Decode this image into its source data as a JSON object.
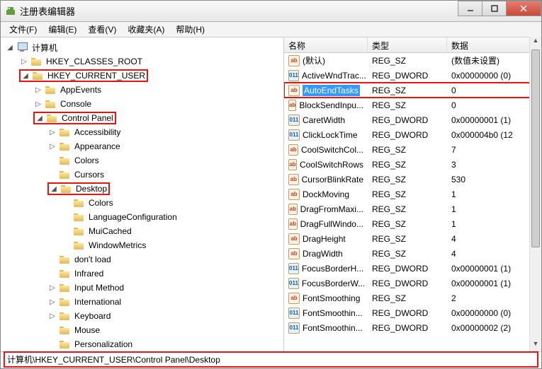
{
  "window": {
    "title": "注册表编辑器"
  },
  "menu": {
    "file": "文件(F)",
    "edit": "编辑(E)",
    "view": "查看(V)",
    "favorites": "收藏夹(A)",
    "help": "帮助(H)"
  },
  "tree": {
    "root": "计算机",
    "hkcr": "HKEY_CLASSES_ROOT",
    "hkcu": "HKEY_CURRENT_USER",
    "appevents": "AppEvents",
    "console": "Console",
    "controlpanel": "Control Panel",
    "accessibility": "Accessibility",
    "appearance": "Appearance",
    "colors": "Colors",
    "cursors": "Cursors",
    "desktop": "Desktop",
    "desktop_colors": "Colors",
    "languageconfig": "LanguageConfiguration",
    "muicached": "MuiCached",
    "windowmetrics": "WindowMetrics",
    "dontload": "don't load",
    "infrared": "Infrared",
    "inputmethod": "Input Method",
    "international": "International",
    "keyboard": "Keyboard",
    "mouse": "Mouse",
    "personalization": "Personalization"
  },
  "columns": {
    "name": "名称",
    "type": "类型",
    "data": "数据"
  },
  "rows": [
    {
      "icon": "sz",
      "name": "(默认)",
      "type": "REG_SZ",
      "data": "(数值未设置)"
    },
    {
      "icon": "bin",
      "name": "ActiveWndTrac...",
      "type": "REG_DWORD",
      "data": "0x00000000 (0)"
    },
    {
      "icon": "sz",
      "name": "AutoEndTasks",
      "type": "REG_SZ",
      "data": "0",
      "selected": true,
      "highlight": true
    },
    {
      "icon": "sz",
      "name": "BlockSendInpu...",
      "type": "REG_SZ",
      "data": "0"
    },
    {
      "icon": "bin",
      "name": "CaretWidth",
      "type": "REG_DWORD",
      "data": "0x00000001 (1)"
    },
    {
      "icon": "bin",
      "name": "ClickLockTime",
      "type": "REG_DWORD",
      "data": "0x000004b0 (12"
    },
    {
      "icon": "sz",
      "name": "CoolSwitchCol...",
      "type": "REG_SZ",
      "data": "7"
    },
    {
      "icon": "sz",
      "name": "CoolSwitchRows",
      "type": "REG_SZ",
      "data": "3"
    },
    {
      "icon": "sz",
      "name": "CursorBlinkRate",
      "type": "REG_SZ",
      "data": "530"
    },
    {
      "icon": "sz",
      "name": "DockMoving",
      "type": "REG_SZ",
      "data": "1"
    },
    {
      "icon": "sz",
      "name": "DragFromMaxi...",
      "type": "REG_SZ",
      "data": "1"
    },
    {
      "icon": "sz",
      "name": "DragFullWindo...",
      "type": "REG_SZ",
      "data": "1"
    },
    {
      "icon": "sz",
      "name": "DragHeight",
      "type": "REG_SZ",
      "data": "4"
    },
    {
      "icon": "sz",
      "name": "DragWidth",
      "type": "REG_SZ",
      "data": "4"
    },
    {
      "icon": "bin",
      "name": "FocusBorderH...",
      "type": "REG_DWORD",
      "data": "0x00000001 (1)"
    },
    {
      "icon": "bin",
      "name": "FocusBorderW...",
      "type": "REG_DWORD",
      "data": "0x00000001 (1)"
    },
    {
      "icon": "sz",
      "name": "FontSmoothing",
      "type": "REG_SZ",
      "data": "2"
    },
    {
      "icon": "bin",
      "name": "FontSmoothin...",
      "type": "REG_DWORD",
      "data": "0x00000000 (0)"
    },
    {
      "icon": "bin",
      "name": "FontSmoothin...",
      "type": "REG_DWORD",
      "data": "0x00000002 (2)"
    }
  ],
  "statusbar": {
    "path": "计算机\\HKEY_CURRENT_USER\\Control Panel\\Desktop"
  }
}
